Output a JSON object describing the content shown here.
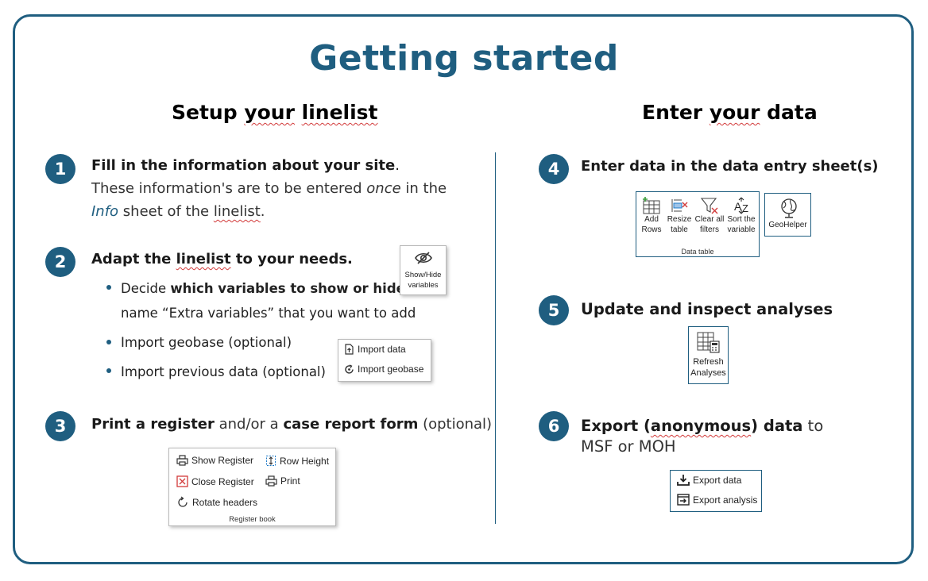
{
  "title": "Getting started",
  "left": {
    "heading_pre": "Setup ",
    "heading_squig1": "your",
    "heading_mid": " ",
    "heading_squig2": "linelist",
    "step1": {
      "num": "1",
      "bold": "Fill in the information about your site",
      "end": ".",
      "line2a": "These information's are to be entered ",
      "line2b": "once",
      "line2c": " in the",
      "line3a": "Info",
      "line3b": " sheet of the ",
      "line3c": "linelist",
      "line3d": "."
    },
    "step2": {
      "num": "2",
      "bold_a": "Adapt the ",
      "bold_b": "linelist",
      "bold_c": " to your needs.",
      "b1a": "Decide ",
      "b1b": "which variables to show or hide",
      "b1c": ";",
      "b1d": "name “Extra variables” that you want to add",
      "b2": "Import geobase (optional)",
      "b3": "Import previous data (optional)",
      "show_hide_label1": "Show/Hide",
      "show_hide_label2": "variables",
      "import_data": "Import data",
      "import_geobase": "Import geobase"
    },
    "step3": {
      "num": "3",
      "a": "Print a register",
      "b": " and/or a ",
      "c": "case report form",
      "d": " (optional)",
      "show_register": "Show Register",
      "row_height": "Row Height",
      "close_register": "Close Register",
      "print": "Print",
      "rotate_headers": "Rotate headers",
      "caption": "Register book"
    }
  },
  "right": {
    "heading_pre": "Enter ",
    "heading_squig": "your",
    "heading_post": " data",
    "step4": {
      "num": "4",
      "text": "Enter data in the data entry sheet(s)",
      "add_rows_1": "Add",
      "add_rows_2": "Rows",
      "resize_1": "Resize",
      "resize_2": "table",
      "clear_1": "Clear all",
      "clear_2": "filters",
      "sort_1": "Sort the",
      "sort_2": "variable",
      "caption": "Data table",
      "geohelper": "GeoHelper"
    },
    "step5": {
      "num": "5",
      "text": "Update and inspect analyses",
      "refresh_1": "Refresh",
      "refresh_2": "Analyses"
    },
    "step6": {
      "num": "6",
      "a": "Export (",
      "b": "anonymous",
      "c": ") data",
      "d": " to",
      "e": "MSF or MOH",
      "export_data": "Export data",
      "export_analysis": "Export analysis"
    }
  },
  "colors": {
    "accent": "#1f5e80",
    "squiggle": "#d23a3a"
  },
  "icons": [
    "eye-slash-icon",
    "import-data-icon",
    "import-geobase-icon",
    "show-register-icon",
    "row-height-icon",
    "close-register-icon",
    "print-icon",
    "rotate-headers-icon",
    "add-rows-icon",
    "resize-table-icon",
    "clear-filters-icon",
    "sort-icon",
    "globe-icon",
    "refresh-analyses-icon",
    "export-data-icon",
    "export-analysis-icon"
  ]
}
